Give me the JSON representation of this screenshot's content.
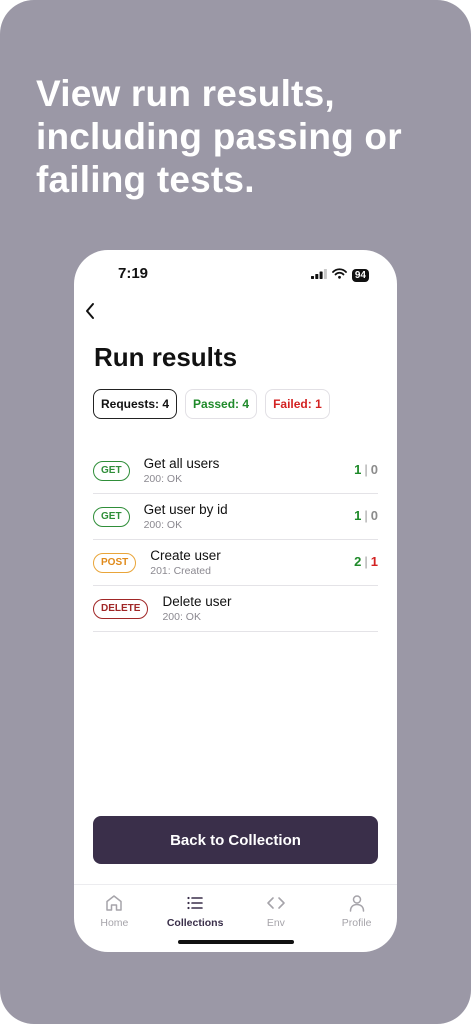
{
  "headline": {
    "lines": [
      "View run results,",
      "including passing or",
      "failing tests."
    ]
  },
  "status_bar": {
    "time": "7:19",
    "battery": "94",
    "icons": [
      "signal-icon",
      "wifi-icon",
      "battery-icon"
    ]
  },
  "navigation": {
    "back_icon": "chevron-left-icon"
  },
  "page": {
    "title": "Run results"
  },
  "summary": {
    "requests": "Requests: 4",
    "passed": "Passed: 4",
    "failed": "Failed: 1"
  },
  "results": [
    {
      "method": "GET",
      "name": "Get all users",
      "status": "200: OK",
      "passed": "1",
      "separator": "|",
      "failed": "0"
    },
    {
      "method": "GET",
      "name": "Get user by id",
      "status": "200: OK",
      "passed": "1",
      "separator": "|",
      "failed": "0"
    },
    {
      "method": "POST",
      "name": "Create user",
      "status": "201: Created",
      "passed": "2",
      "separator": "|",
      "failed": "1"
    },
    {
      "method": "DELETE",
      "name": "Delete user",
      "status": "200: OK",
      "passed": "",
      "separator": "",
      "failed": ""
    }
  ],
  "actions": {
    "back_to_collection": "Back to Collection"
  },
  "tabbar": {
    "tabs": [
      {
        "label": "Home",
        "icon": "home-icon"
      },
      {
        "label": "Collections",
        "icon": "list-icon",
        "active": true
      },
      {
        "label": "Env",
        "icon": "code-icon"
      },
      {
        "label": "Profile",
        "icon": "user-icon"
      }
    ]
  },
  "colors": {
    "background": "#9b98a6",
    "primary": "#3a2f4a",
    "pass": "#1f8a2a",
    "fail": "#d32222",
    "get": "#2f8e39",
    "post": "#e08a1a",
    "delete": "#a02626"
  }
}
